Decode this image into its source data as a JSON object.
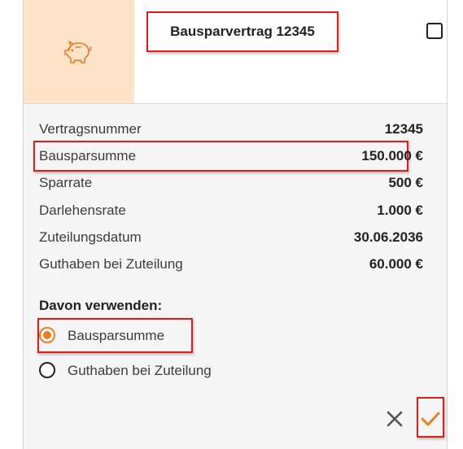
{
  "card": {
    "title": "Bausparvertrag 12345",
    "icon": "piggy-bank-icon",
    "details": [
      {
        "label": "Vertragsnummer",
        "value": "12345"
      },
      {
        "label": "Bausparsumme",
        "value": "150.000 €"
      },
      {
        "label": "Sparrate",
        "value": "500 €"
      },
      {
        "label": "Darlehensrate",
        "value": "1.000 €"
      },
      {
        "label": "Zuteilungsdatum",
        "value": "30.06.2036"
      },
      {
        "label": "Guthaben bei Zuteilung",
        "value": "60.000 €"
      }
    ],
    "use_label": "Davon verwenden:",
    "options": [
      {
        "label": "Bausparsumme",
        "selected": true
      },
      {
        "label": "Guthaben bei Zuteilung",
        "selected": false
      }
    ],
    "actions": {
      "cancel_icon": "close-icon",
      "confirm_icon": "check-icon"
    }
  },
  "colors": {
    "accent": "#f07b1e",
    "icon_background": "#fde3c8",
    "highlight": "#e21b1b",
    "card_background": "#f5f5f5"
  }
}
